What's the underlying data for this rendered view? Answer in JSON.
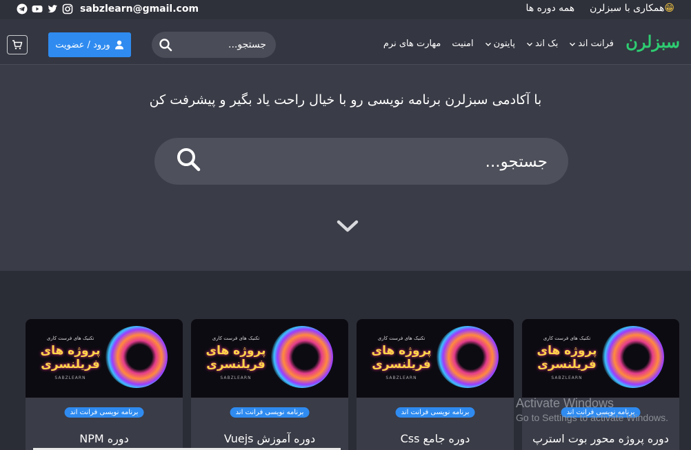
{
  "topbar": {
    "email": "sabzlearn@gmail.com",
    "socials": [
      "telegram-icon",
      "youtube-icon",
      "twitter-icon",
      "instagram-icon"
    ],
    "links": [
      {
        "label": "همکاری با سبزلرن",
        "emoji": "😁"
      },
      {
        "label": "همه دوره ها"
      }
    ]
  },
  "nav": {
    "logo": "سبزلرن",
    "menu": [
      {
        "label": "فرانت اند",
        "dropdown": true
      },
      {
        "label": "بک اند",
        "dropdown": true
      },
      {
        "label": "پایتون",
        "dropdown": true
      },
      {
        "label": "امنیت",
        "dropdown": false
      },
      {
        "label": "مهارت های نرم",
        "dropdown": false
      }
    ],
    "search_placeholder": "جستجو...",
    "login_label": "ورود / عضویت",
    "cart_icon": "cart-icon"
  },
  "hero": {
    "title": "با آکادمی سبزلرن برنامه نویسی رو با خیال راحت یاد بگیر و پیشرفت کن",
    "search_placeholder": "جستجو..."
  },
  "courses": [
    {
      "thumb_small": "تکنیک های فرست کاری",
      "thumb_big": "پروژه های فریلنسری",
      "thumb_brand": "SABZLEARN",
      "category": "برنامه نویسی فرانت اند",
      "title": "دوره NPM"
    },
    {
      "thumb_small": "تکنیک های فرست کاری",
      "thumb_big": "پروژه های فریلنسری",
      "thumb_brand": "SABZLEARN",
      "category": "برنامه نویسی فرانت اند",
      "title": "دوره آموزش Vuejs"
    },
    {
      "thumb_small": "تکنیک های فرست کاری",
      "thumb_big": "پروژه های فریلنسری",
      "thumb_brand": "SABZLEARN",
      "category": "برنامه نویسی فرانت اند",
      "title": "دوره جامع Css"
    },
    {
      "thumb_small": "تکنیک های فرست کاری",
      "thumb_big": "پروژه های فریلنسری",
      "thumb_brand": "SABZLEARN",
      "category": "برنامه نویسی فرانت اند",
      "title": "دوره پروژه محور بوت استرپ"
    }
  ],
  "watermark": {
    "line1": "Activate Windows",
    "line2": "Go to Settings to activate Windows."
  },
  "colors": {
    "accent": "#2f8bf0",
    "brand": "#2ecc71",
    "background": "#2b2d36"
  }
}
